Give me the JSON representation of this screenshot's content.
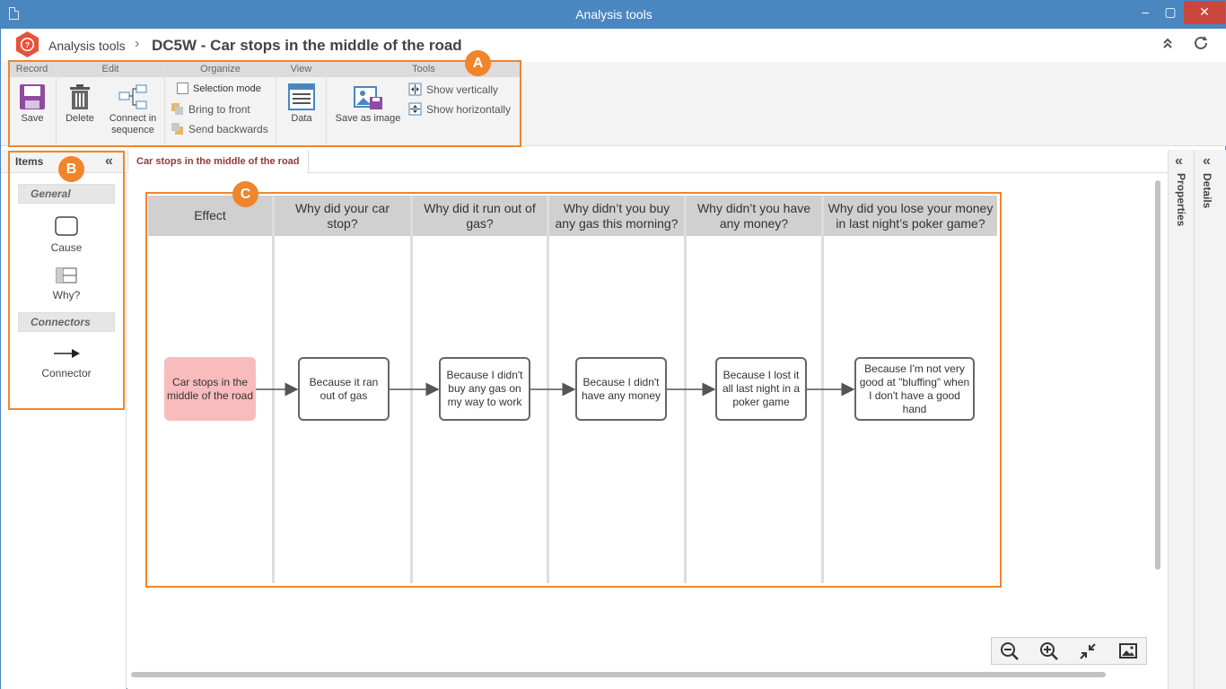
{
  "window": {
    "title": "Analysis tools",
    "minimize": "–",
    "maximize": "▢",
    "close": "✕"
  },
  "header": {
    "logo": "question-mark-hexagon-icon",
    "breadcrumb_root": "Analysis tools",
    "breadcrumb_sep": "›",
    "page_title": "DC5W - Car stops in the middle of the road",
    "collapse": "«",
    "refresh": "⟳"
  },
  "ribbon": {
    "groups": {
      "record": "Record",
      "edit": "Edit",
      "organize": "Organize",
      "view": "View",
      "tools": "Tools"
    },
    "save": "Save",
    "delete": "Delete",
    "connect_line1": "Connect in",
    "connect_line2": "sequence",
    "selection_mode": "Selection mode",
    "bring_to_front": "Bring to front",
    "send_backwards": "Send backwards",
    "data": "Data",
    "save_as_image": "Save as image",
    "show_vertically": "Show vertically",
    "show_horizontally": "Show horizontally"
  },
  "badges": {
    "a": "A",
    "b": "B",
    "c": "C"
  },
  "items_panel": {
    "title": "Items",
    "collapse": "«",
    "general": "General",
    "cause": "Cause",
    "why": "Why?",
    "connectors": "Connectors",
    "connector": "Connector"
  },
  "tabs": {
    "active": "Car stops in the middle of the road"
  },
  "diagram": {
    "columns": [
      "Effect",
      "Why did your car stop?",
      "Why did it run out of gas?",
      "Why didn’t you buy any gas this morning?",
      "Why didn’t you have any money?",
      "Why did you lose your money in last night’s poker game?"
    ],
    "nodes": [
      "Car stops in the middle of the road",
      "Because it ran out of gas",
      "Because I didn't buy any gas on my way to work",
      "Because I didn't have any money",
      "Because I lost it all last night in a poker game",
      "Because I'm not very good at \"bluffing\" when I don't have a good hand"
    ],
    "effect_color": "#f9bcbc"
  },
  "zoom": {
    "zoom_out": "⊖",
    "zoom_in": "⊕",
    "fit": "⤡",
    "image": "▣"
  },
  "side": {
    "properties": "Properties",
    "details": "Details",
    "chev": "«"
  },
  "colors": {
    "accent_orange": "#f0852b",
    "title_blue": "#4a86c0",
    "close_red": "#c9463d"
  }
}
